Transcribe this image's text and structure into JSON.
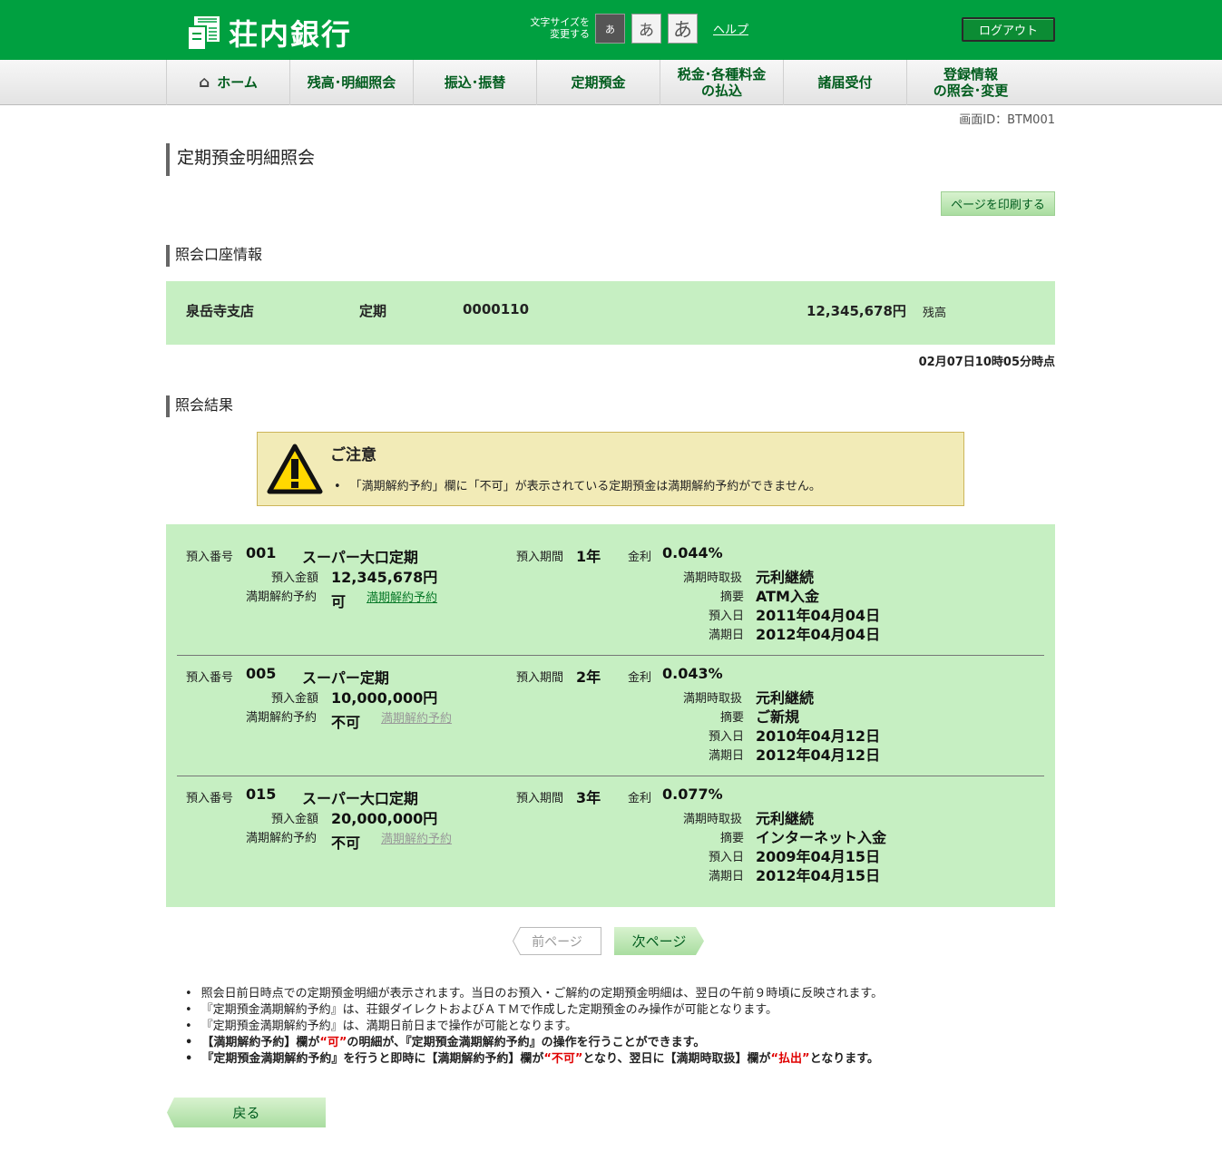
{
  "header": {
    "logo_text": "荘内銀行",
    "font_size_label_1": "文字サイズを",
    "font_size_label_2": "変更する",
    "font_small": "あ",
    "font_medium": "あ",
    "font_large": "あ",
    "help": "ヘルプ",
    "logout": "ログアウト"
  },
  "nav": {
    "home": "ホーム",
    "balance": "残高･明細照会",
    "transfer": "振込･振替",
    "time_deposit": "定期預金",
    "tax_1": "税金･各種料金",
    "tax_2": "の払込",
    "notifications": "諸届受付",
    "registration_1": "登録情報",
    "registration_2": "の照会･変更"
  },
  "screen_id": "画面ID：BTM001",
  "page_title": "定期預金明細照会",
  "print_button": "ページを印刷する",
  "account_section_title": "照会口座情報",
  "account": {
    "branch": "泉岳寺支店",
    "type": "定期",
    "number": "0000110",
    "balance": "12,345,678円",
    "balance_label": "残高"
  },
  "timestamp": "02月07日10時05分時点",
  "results_section_title": "照会結果",
  "notice": {
    "title": "ご注意",
    "text": "「満期解約予約」欄に「不可」が表示されている定期預金は満期解約予約ができません。"
  },
  "labels": {
    "deposit_no": "預入番号",
    "amount": "預入金額",
    "cancel_reservation": "満期解約予約",
    "period": "預入期間",
    "rate": "金利",
    "maturity_handling": "満期時取扱",
    "memo": "摘要",
    "deposit_date": "預入日",
    "maturity_date": "満期日",
    "cancel_link": "満期解約予約"
  },
  "records": [
    {
      "no": "001",
      "product": "スーパー大口定期",
      "amount": "12,345,678円",
      "cancel_status": "可",
      "period": "1年",
      "rate": "0.044%",
      "maturity_handling": "元利継続",
      "memo": "ATM入金",
      "deposit_date": "2011年04月04日",
      "maturity_date": "2012年04月04日"
    },
    {
      "no": "005",
      "product": "スーパー定期",
      "amount": "10,000,000円",
      "cancel_status": "不可",
      "period": "2年",
      "rate": "0.043%",
      "maturity_handling": "元利継続",
      "memo": "ご新規",
      "deposit_date": "2010年04月12日",
      "maturity_date": "2012年04月12日"
    },
    {
      "no": "015",
      "product": "スーパー大口定期",
      "amount": "20,000,000円",
      "cancel_status": "不可",
      "period": "3年",
      "rate": "0.077%",
      "maturity_handling": "元利継続",
      "memo": "インターネット入金",
      "deposit_date": "2009年04月15日",
      "maturity_date": "2012年04月15日"
    }
  ],
  "pagination": {
    "prev": "前ページ",
    "next": "次ページ"
  },
  "notes": {
    "n1": "照会日前日時点での定期預金明細が表示されます。当日のお預入・ご解約の定期預金明細は、翌日の午前９時頃に反映されます。",
    "n2": "『定期預金満期解約予約』は、荘銀ダイレクトおよびＡＴＭで作成した定期預金のみ操作が可能となります。",
    "n3": "『定期預金満期解約予約』は、満期日前日まで操作が可能となります。",
    "n4_a": "【満期解約予約】欄が",
    "n4_red": "“可”",
    "n4_b": "の明細が、『定期預金満期解約予約』の操作を行うことができます。",
    "n5_a": "『定期預金満期解約予約』を行うと即時に【満期解約予約】欄が",
    "n5_red1": "“不可”",
    "n5_b": "となり、翌日に【満期時取扱】欄が",
    "n5_red2": "“払出”",
    "n5_c": "となります。"
  },
  "back_button": "戻る"
}
